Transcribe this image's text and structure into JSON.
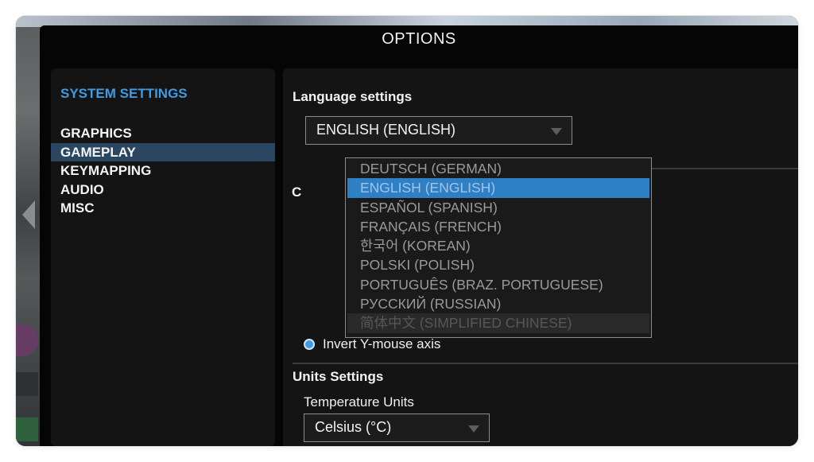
{
  "window": {
    "title": "OPTIONS"
  },
  "sidebar": {
    "heading": "SYSTEM SETTINGS",
    "items": [
      {
        "label": "GRAPHICS",
        "active": false
      },
      {
        "label": "GAMEPLAY",
        "active": true
      },
      {
        "label": "KEYMAPPING",
        "active": false
      },
      {
        "label": "AUDIO",
        "active": false
      },
      {
        "label": "MISC",
        "active": false
      }
    ]
  },
  "language": {
    "section_title": "Language settings",
    "selected": "ENGLISH (ENGLISH)",
    "options": [
      "DEUTSCH (GERMAN)",
      "ENGLISH (ENGLISH)",
      "ESPAÑOL (SPANISH)",
      "FRANÇAIS (FRENCH)",
      "한국어 (KOREAN)",
      "POLSKI (POLISH)",
      "PORTUGUÊS (BRAZ. PORTUGUESE)",
      "РУССКИЙ (RUSSIAN)",
      "简体中文 (SIMPLIFIED CHINESE)"
    ]
  },
  "controls": {
    "section_title_partial": "C",
    "invert_y_label": "Invert Y-mouse axis",
    "invert_y_checked": true
  },
  "units": {
    "section_title": "Units Settings",
    "temperature_label": "Temperature Units",
    "temperature_value": "Celsius (°C)"
  },
  "colors": {
    "accent": "#3f9be3",
    "selection": "#2f7fc4",
    "active_nav": "#2a4660"
  }
}
